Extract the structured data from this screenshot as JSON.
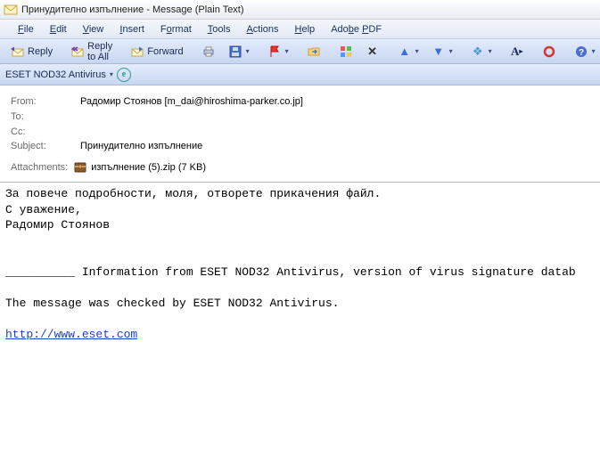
{
  "window": {
    "title": "Принудително изпълнение - Message (Plain Text)"
  },
  "menu": {
    "file": "File",
    "edit": "Edit",
    "view": "View",
    "insert": "Insert",
    "format": "Format",
    "tools": "Tools",
    "actions": "Actions",
    "help": "Help",
    "adobe": "Adobe PDF"
  },
  "toolbar": {
    "reply": "Reply",
    "reply_all": "Reply to All",
    "forward": "Forward"
  },
  "eset": {
    "label": "ESET NOD32 Antivirus",
    "icon_letter": "e"
  },
  "headers": {
    "from_label": "From:",
    "from_value": "Радомир Стоянов [m_dai@hiroshima-parker.co.jp]",
    "to_label": "To:",
    "to_value": "",
    "cc_label": "Cc:",
    "cc_value": "",
    "subject_label": "Subject:",
    "subject_value": "Принудително изпълнение"
  },
  "attachment": {
    "label": "Attachments:",
    "filename": "изпълнение (5).zip (7 KB)"
  },
  "body": {
    "line1": "За повече подробности, моля, отворете прикачения файл.",
    "line2": "С уважение,",
    "line3": "Радомир Стоянов",
    "sep": "__________ Information from ESET NOD32 Antivirus, version of virus signature datab",
    "checked": "The message was checked by ESET NOD32 Antivirus.",
    "link": "http://www.eset.com"
  }
}
